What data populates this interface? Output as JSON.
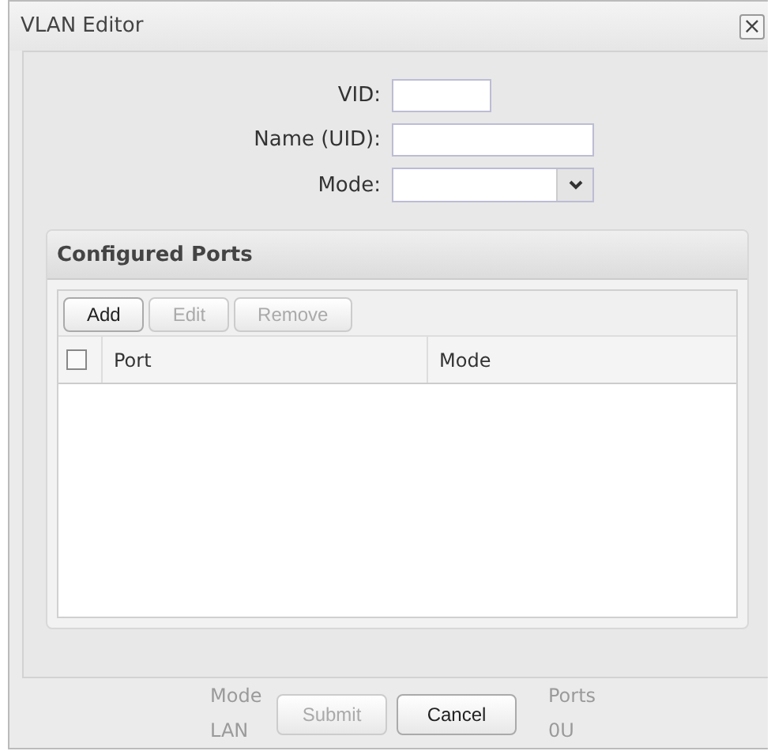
{
  "window": {
    "title": "VLAN Editor",
    "close": "×"
  },
  "fields": [
    {
      "label": "VID:",
      "kind": "short"
    },
    {
      "label": "Name (UID):",
      "kind": "long"
    },
    {
      "label": "Mode:",
      "kind": "select"
    }
  ],
  "configured_ports": {
    "title": "Configured Ports",
    "toolbar": [
      {
        "label": "Add",
        "disabled": false
      },
      {
        "label": "Edit",
        "disabled": true
      },
      {
        "label": "Remove",
        "disabled": true
      }
    ],
    "select_all": {
      "checked": false
    },
    "columns": [
      "Port",
      "Mode"
    ]
  },
  "background_table": {
    "columns": [
      "Mode",
      "Ports"
    ],
    "row": [
      "LAN",
      "0U"
    ]
  },
  "buttons": [
    {
      "label": "Submit",
      "disabled": true
    },
    {
      "label": "Cancel",
      "disabled": false
    }
  ]
}
